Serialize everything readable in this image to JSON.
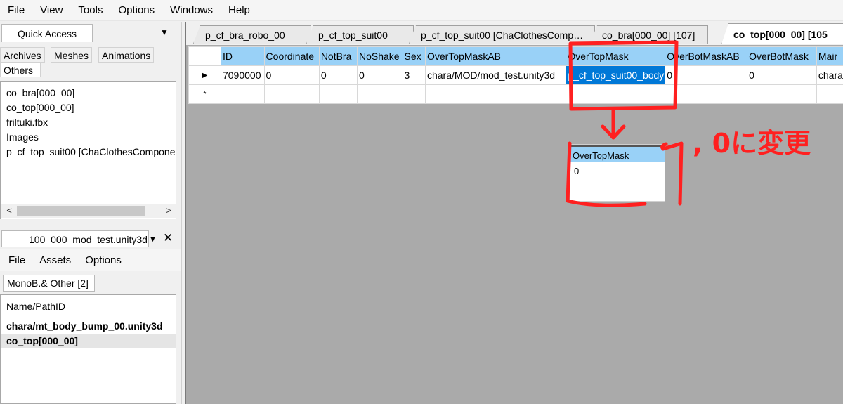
{
  "menubar": {
    "items": [
      "File",
      "View",
      "Tools",
      "Options",
      "Windows",
      "Help"
    ]
  },
  "left_pane": {
    "quick_access_tab": "Quick Access",
    "category_tabs": [
      "Archives",
      "Meshes",
      "Animations",
      "Others"
    ],
    "list_items": [
      "co_bra[000_00]",
      "co_top[000_00]",
      "friltuki.fbx",
      "Images",
      "p_cf_top_suit00 [ChaClothesCompone"
    ],
    "file_tab": "100_000_mod_test.unity3d",
    "sub_menu": [
      "File",
      "Assets",
      "Options"
    ],
    "mono_tab": "MonoB.& Other [2]",
    "asset_header": "Name/PathID",
    "asset_rows": [
      "chara/mt_body_bump_00.unity3d",
      "co_top[000_00]"
    ]
  },
  "doc_tabs": [
    "p_cf_bra_robo_00",
    "p_cf_top_suit00",
    "p_cf_top_suit00 [ChaClothesComp…",
    "co_bra[000_00] [107]",
    "co_top[000_00] [105"
  ],
  "grid": {
    "columns": [
      "ID",
      "Coordinate",
      "NotBra",
      "NoShake",
      "Sex",
      "OverTopMaskAB",
      "OverTopMask",
      "OverBotMaskAB",
      "OverBotMask",
      "Mair"
    ],
    "row": [
      "7090000",
      "0",
      "0",
      "0",
      "3",
      "chara/MOD/mod_test.unity3d",
      "p_cf_top_suit00_body",
      "0",
      "0",
      "chara"
    ],
    "new_row_marker": "*",
    "current_row_marker": "▶"
  },
  "popup": {
    "header": "OverTopMask",
    "value": "0"
  },
  "annotation": {
    "text": ", 0に変更",
    "color": "#ff2020"
  },
  "colors": {
    "header_bg": "#99d1f7",
    "selection": "#0078d7",
    "workspace": "#aaaaaa"
  }
}
